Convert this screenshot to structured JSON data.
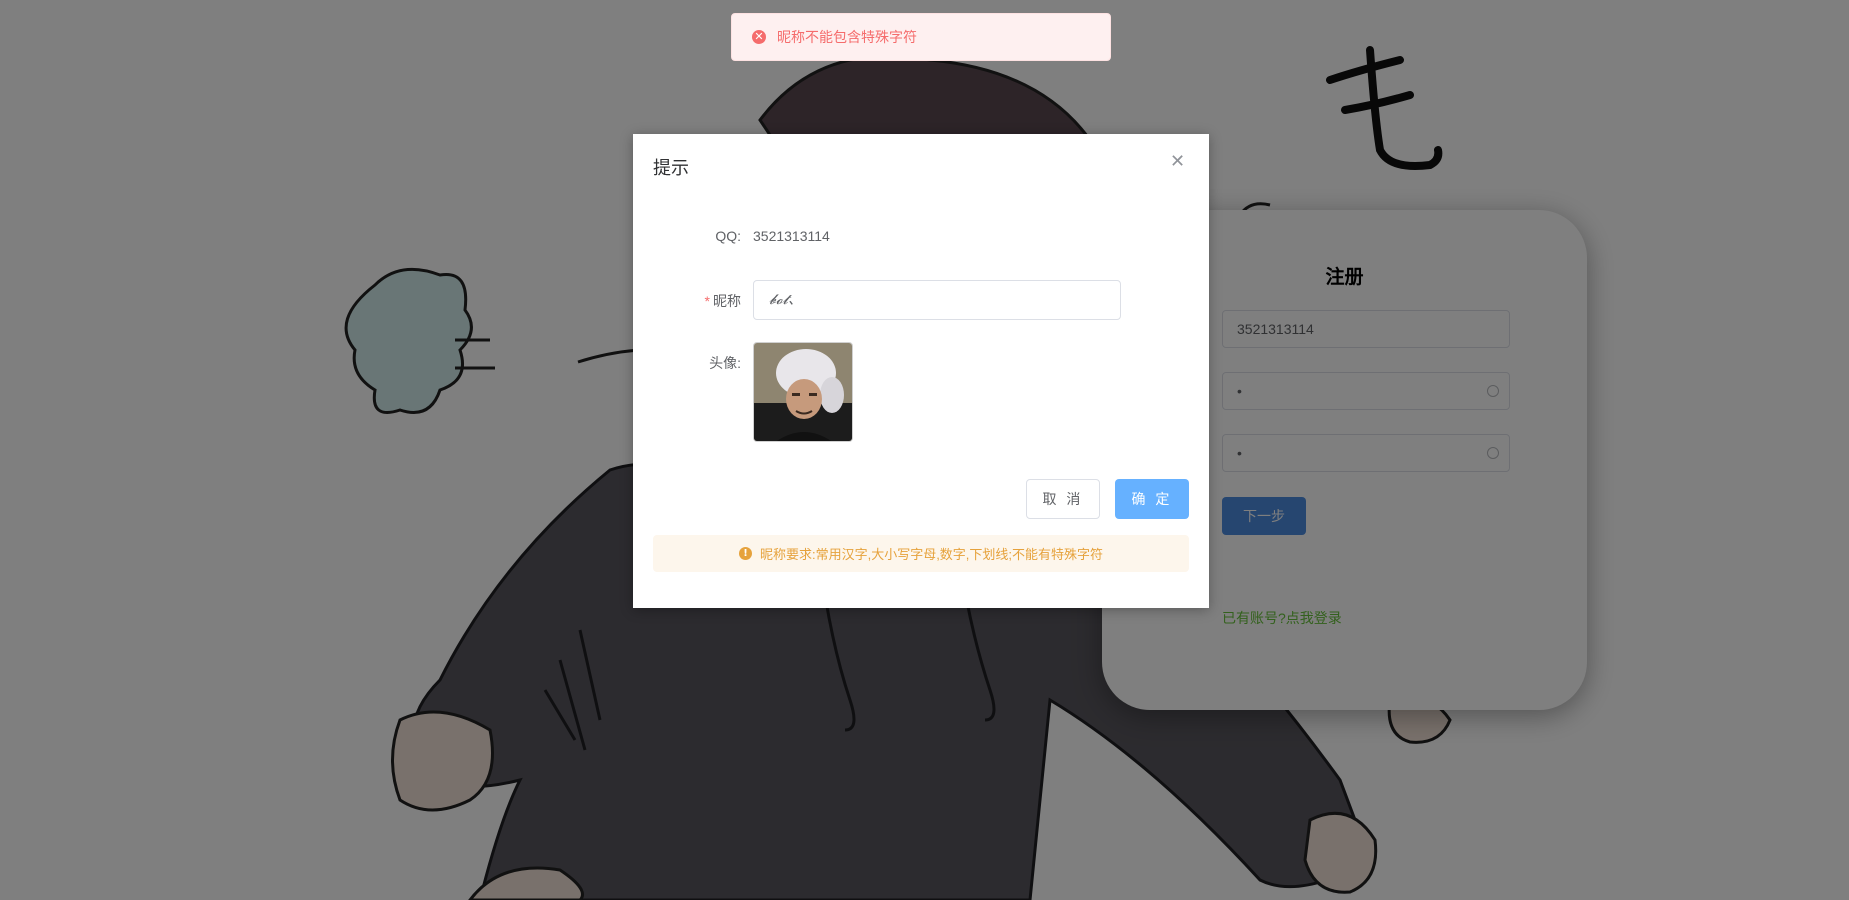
{
  "message": {
    "text": "昵称不能包含特殊字符",
    "icon": "error-circle-icon",
    "color": "#f56c6c"
  },
  "dialog": {
    "title": "提示",
    "close_icon": "close-icon",
    "qq_label": "QQ:",
    "qq_value": "3521313114",
    "nickname_label": "昵称",
    "nickname_value": "𝓫𝓸𝓽、",
    "avatar_label": "头像:",
    "cancel_label": "取 消",
    "confirm_label": "确 定",
    "hint_icon": "warning-circle-icon",
    "hint_text": "昵称要求:常用汉字,大小写字母,数字,下划线;不能有特殊字符"
  },
  "register": {
    "title": "注册",
    "qq_value": "3521313114",
    "password_value": "•",
    "confirm_password_value": "•",
    "next_label": "下一步",
    "login_link": "已有账号?点我登录"
  },
  "colors": {
    "primary": "#409eff",
    "danger": "#f56c6c",
    "warning": "#e6a23c",
    "success": "#67c23a"
  }
}
